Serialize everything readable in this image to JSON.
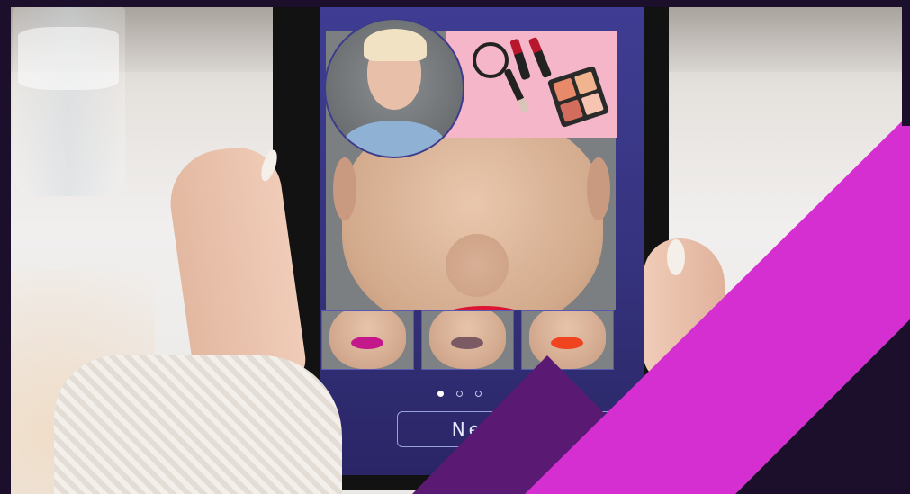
{
  "app": {
    "next_label": "Next",
    "pagination": {
      "total": 3,
      "current": 1
    }
  },
  "thumbnails": [
    {
      "label": "",
      "lip_color": "#c2188a"
    },
    {
      "label": "",
      "lip_color": "#7b5a63"
    },
    {
      "label": "",
      "lip_color": "#f0431f"
    }
  ],
  "colors": {
    "frame": "#1b0f2b",
    "accent_magenta": "#d62fd1",
    "accent_purple": "#5a1a73",
    "screen_top": "#3f3d93",
    "main_lip": "#e8162f"
  }
}
